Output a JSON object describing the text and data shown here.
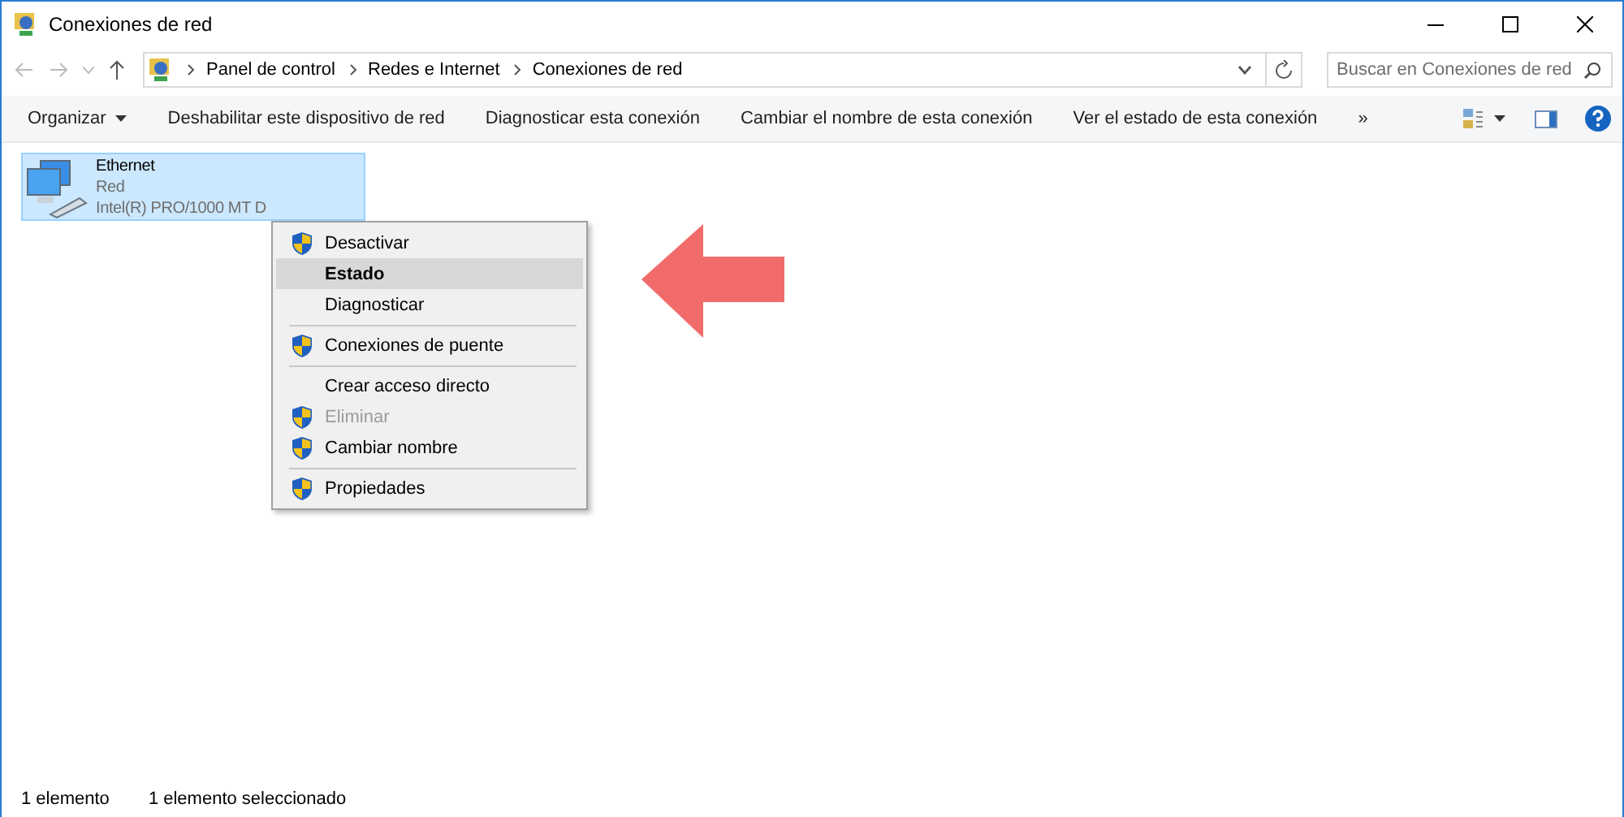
{
  "window": {
    "title": "Conexiones de red"
  },
  "address_bar": {
    "breadcrumbs": [
      "Panel de control",
      "Redes e Internet",
      "Conexiones de red"
    ]
  },
  "search": {
    "placeholder": "Buscar en Conexiones de red"
  },
  "toolbar": {
    "items": [
      {
        "label": "Organizar",
        "kind": "dropdown"
      },
      {
        "label": "Deshabilitar este dispositivo de red",
        "kind": "plain"
      },
      {
        "label": "Diagnosticar esta conexión",
        "kind": "plain"
      },
      {
        "label": "Cambiar el nombre de esta conexión",
        "kind": "plain"
      },
      {
        "label": "Ver el estado de esta conexión",
        "kind": "plain"
      },
      {
        "label": "»",
        "kind": "plain"
      }
    ]
  },
  "connections": [
    {
      "name": "Ethernet",
      "network": "Red",
      "adapter": "Intel(R) PRO/1000 MT D",
      "selected": true
    }
  ],
  "context_menu": {
    "items": [
      {
        "kind": "item",
        "label": "Desactivar",
        "shield": true,
        "selected": false,
        "disabled": false,
        "default": false
      },
      {
        "kind": "item",
        "label": "Estado",
        "shield": false,
        "selected": true,
        "disabled": false,
        "default": true
      },
      {
        "kind": "item",
        "label": "Diagnosticar",
        "shield": false,
        "selected": false,
        "disabled": false,
        "default": false
      },
      {
        "kind": "separator"
      },
      {
        "kind": "item",
        "label": "Conexiones de puente",
        "shield": true,
        "selected": false,
        "disabled": false,
        "default": false
      },
      {
        "kind": "separator"
      },
      {
        "kind": "item",
        "label": "Crear acceso directo",
        "shield": false,
        "selected": false,
        "disabled": false,
        "default": false
      },
      {
        "kind": "item",
        "label": "Eliminar",
        "shield": true,
        "selected": false,
        "disabled": true,
        "default": false
      },
      {
        "kind": "item",
        "label": "Cambiar nombre",
        "shield": true,
        "selected": false,
        "disabled": false,
        "default": false
      },
      {
        "kind": "separator"
      },
      {
        "kind": "item",
        "label": "Propiedades",
        "shield": true,
        "selected": false,
        "disabled": false,
        "default": false
      }
    ]
  },
  "status_bar": [
    "1 elemento",
    "1 elemento seleccionado"
  ]
}
